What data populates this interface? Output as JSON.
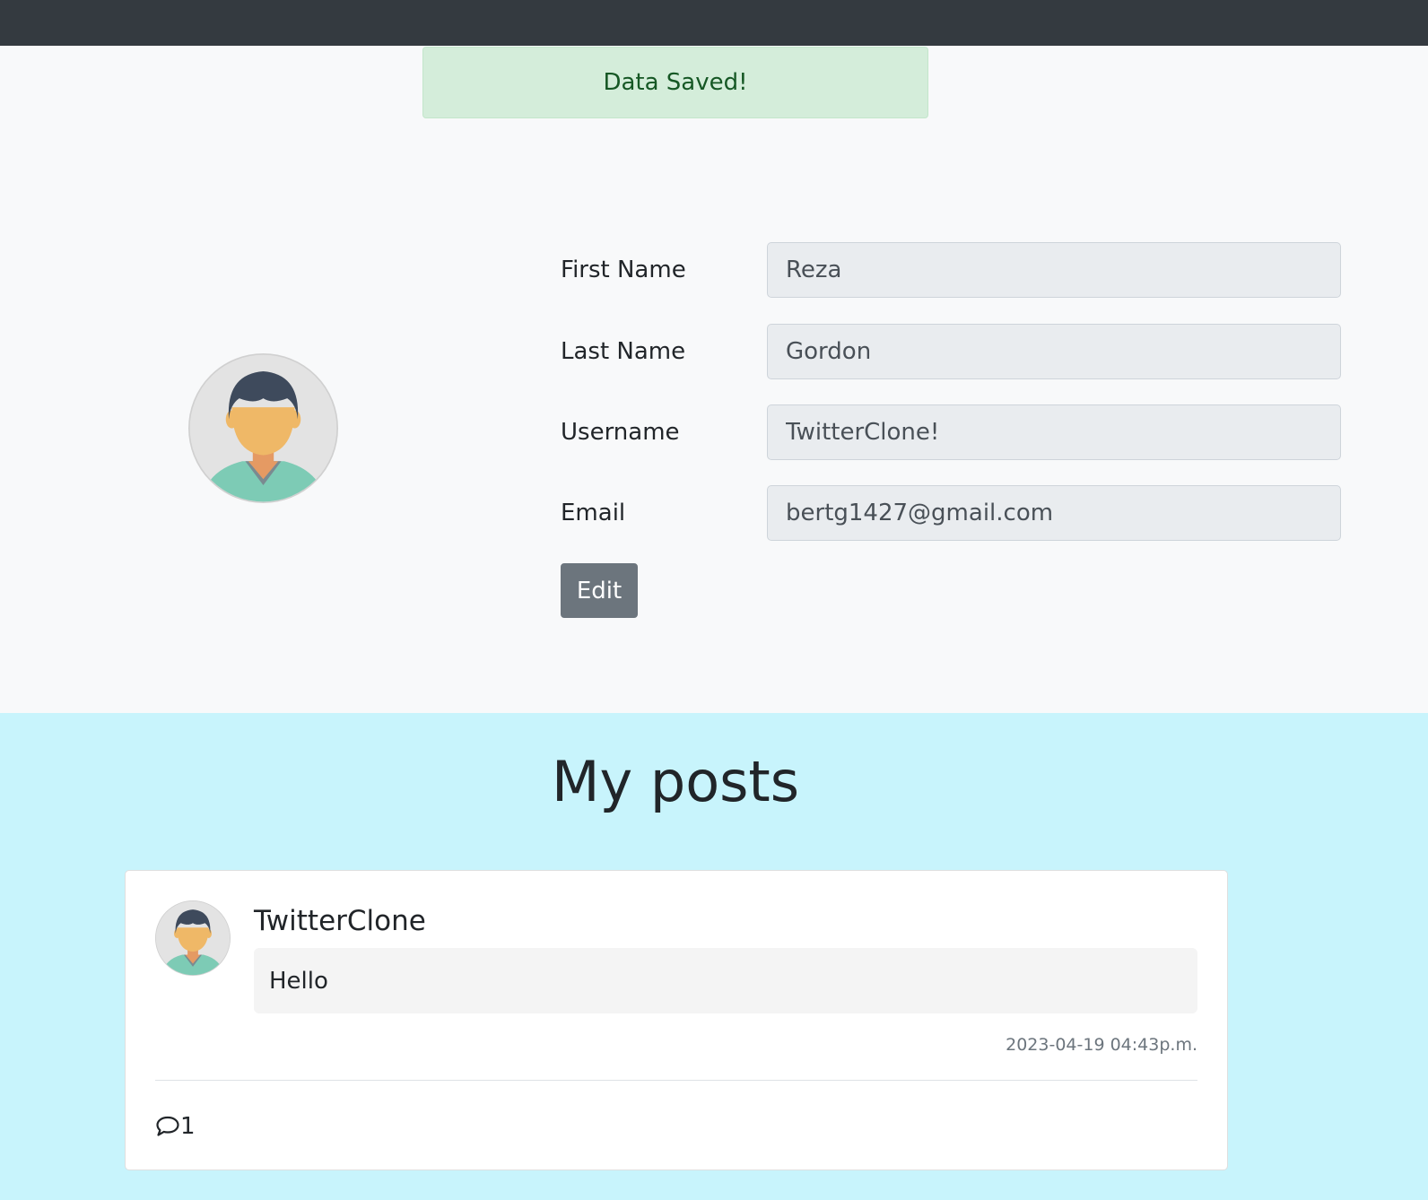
{
  "alert": {
    "message": "Data Saved!"
  },
  "profile": {
    "fields": [
      {
        "label": "First Name",
        "value": "Reza"
      },
      {
        "label": "Last Name",
        "value": "Gordon"
      },
      {
        "label": "Username",
        "value": "TwitterClone!"
      },
      {
        "label": "Email",
        "value": "bertg1427@gmail.com"
      }
    ],
    "edit_label": "Edit",
    "avatar_icon": "user-avatar-icon"
  },
  "posts": {
    "heading": "My posts",
    "items": [
      {
        "author": "TwitterClone",
        "body": "Hello",
        "timestamp": "2023-04-19 04:43p.m.",
        "comment_count": "1"
      }
    ]
  },
  "colors": {
    "topbar": "#343a40",
    "alert_bg": "#d4edda",
    "alert_text": "#155724",
    "posts_bg": "#c8f4fc",
    "edit_button": "#6c757d"
  }
}
